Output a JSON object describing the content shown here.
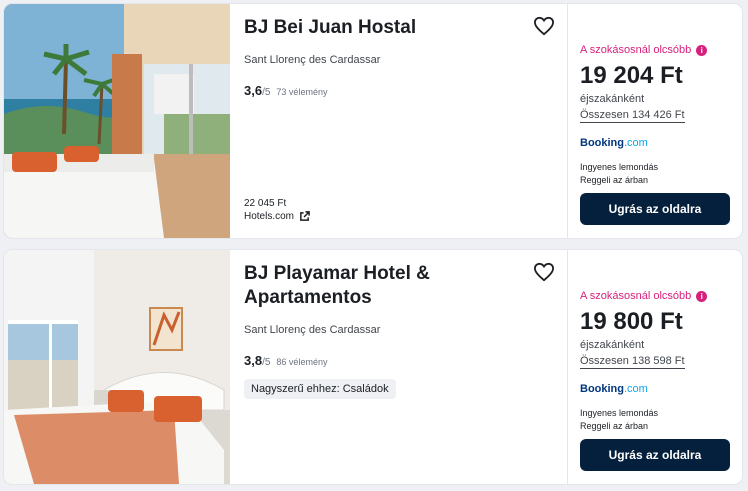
{
  "hotels": [
    {
      "name": "BJ Bei Juan Hostal",
      "location": "Sant Llorenç des Cardassar",
      "score": "3,6",
      "score_max": "/5",
      "reviews": "73 vélemény",
      "badge": "",
      "alt_price": "22 045 Ft",
      "alt_site": "Hotels.com",
      "deal_label": "A szokásosnál olcsóbb",
      "price": "19 204 Ft",
      "per_night": "éjszakánként",
      "total": "Összesen 134 426 Ft",
      "provider_main": "Booking",
      "provider_suffix": ".com",
      "perk1": "Ingyenes lemondás",
      "perk2": "Reggeli az árban",
      "cta": "Ugrás az oldalra"
    },
    {
      "name": "BJ Playamar Hotel & Apartamentos",
      "location": "Sant Llorenç des Cardassar",
      "score": "3,8",
      "score_max": "/5",
      "reviews": "86 vélemény",
      "badge": "Nagyszerű ehhez: Családok",
      "alt_price": "",
      "alt_site": "",
      "deal_label": "A szokásosnál olcsóbb",
      "price": "19 800 Ft",
      "per_night": "éjszakánként",
      "total": "Összesen 138 598 Ft",
      "provider_main": "Booking",
      "provider_suffix": ".com",
      "perk1": "Ingyenes lemondás",
      "perk2": "Reggeli az árban",
      "cta": "Ugrás az oldalra"
    }
  ],
  "colors": {
    "accent": "#d6217c",
    "cta_bg": "#05203c",
    "booking_blue": "#003580",
    "booking_com": "#0ea5e9"
  },
  "icons": {
    "favorite": "heart-icon",
    "external": "external-link-icon",
    "info": "info-icon"
  }
}
